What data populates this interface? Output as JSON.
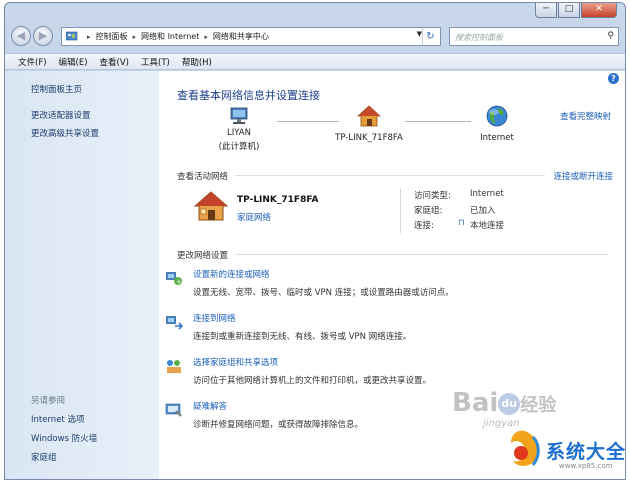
{
  "window": {
    "caption_buttons": [
      "─",
      "□",
      "✕"
    ]
  },
  "address_bar": {
    "crumbs": [
      "控制面板",
      "网络和 Internet",
      "网络和共享中心"
    ],
    "back_icon": "back-arrow-icon",
    "forward_icon": "forward-arrow-icon"
  },
  "search": {
    "placeholder": "搜索控制面板"
  },
  "menu": [
    "文件(F)",
    "编辑(E)",
    "查看(V)",
    "工具(T)",
    "帮助(H)"
  ],
  "sidebar": {
    "items": [
      "控制面板主页",
      "更改适配器设置",
      "更改高级共享设置"
    ],
    "see_also_title": "另请参阅",
    "see_also": [
      "Internet 选项",
      "Windows 防火墙",
      "家庭组"
    ]
  },
  "main": {
    "title": "查看基本网络信息并设置连接",
    "full_map": "查看完整映射",
    "nodes": [
      {
        "label": "LIYAN",
        "sublabel": "(此计算机)"
      },
      {
        "label": "TP-LINK_71F8FA",
        "sublabel": ""
      },
      {
        "label": "Internet",
        "sublabel": ""
      }
    ],
    "active_networks_label": "查看活动网络",
    "connect_disconnect": "连接或断开连接",
    "network": {
      "name": "TP-LINK_71F8FA",
      "type": "家庭网络",
      "access_type_label": "访问类型:",
      "access_type_value": "Internet",
      "homegroup_label": "家庭组:",
      "homegroup_value": "已加入",
      "connections_label": "连接:",
      "connections_value": "本地连接"
    },
    "change_settings_label": "更改网络设置",
    "tasks": [
      {
        "title": "设置新的连接或网络",
        "desc": "设置无线、宽带、拨号、临时或 VPN 连接；或设置路由器或访问点。"
      },
      {
        "title": "连接到网络",
        "desc": "连接到或重新连接到无线、有线、拨号或 VPN 网络连接。"
      },
      {
        "title": "选择家庭组和共享选项",
        "desc": "访问位于其他网络计算机上的文件和打印机，或更改共享设置。"
      },
      {
        "title": "疑难解答",
        "desc": "诊断并修复网络问题，或获得故障排除信息。"
      }
    ]
  },
  "watermarks": {
    "baidu": "Bai",
    "baidu_du": "du",
    "jingyan": "经验",
    "jingyan_url": "jingyan",
    "site_name": "系统大全",
    "site_url": "www.xp85.com"
  },
  "colors": {
    "link": "#1b5fb8",
    "title": "#1e3f8a",
    "sidebar_bg": "#dae6f3"
  }
}
